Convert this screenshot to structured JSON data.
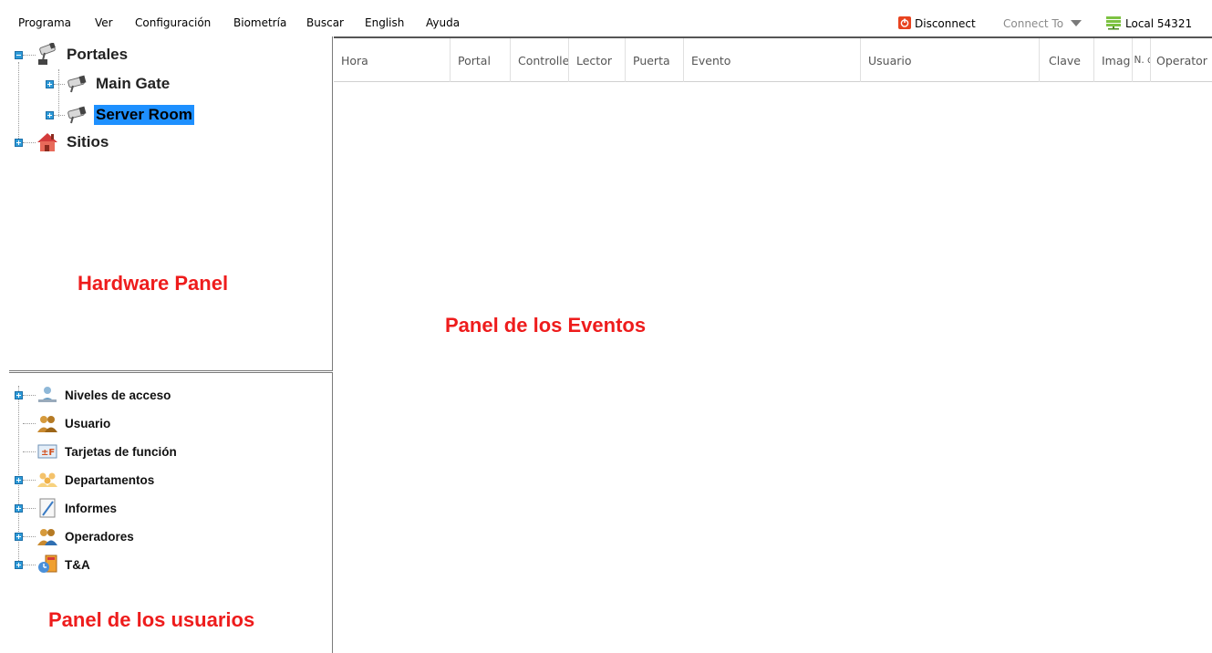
{
  "menu": {
    "items": [
      "Programa",
      "Ver",
      "Configuración",
      "Biometría",
      "Buscar",
      "English",
      "Ayuda"
    ],
    "disconnect_label": "Disconnect",
    "connect_to_label": "Connect To",
    "local_label": "Local 54321"
  },
  "hardware_panel": {
    "root": {
      "label": "Portales",
      "icon": "camera-icon"
    },
    "children": [
      {
        "label": "Main Gate",
        "icon": "camera-icon"
      },
      {
        "label": "Server Room",
        "icon": "camera-icon",
        "selected": true
      }
    ],
    "sites": {
      "label": "Sitios",
      "icon": "house-icon"
    },
    "annotation": "Hardware Panel"
  },
  "user_panel": {
    "items": [
      {
        "label": "Niveles de acceso",
        "icon": "access-level-icon",
        "expandable": true
      },
      {
        "label": "Usuario",
        "icon": "users-icon",
        "expandable": false
      },
      {
        "label": "Tarjetas de función",
        "icon": "function-card-icon",
        "expandable": false
      },
      {
        "label": "Departamentos",
        "icon": "departments-icon",
        "expandable": true
      },
      {
        "label": "Informes",
        "icon": "reports-icon",
        "expandable": true
      },
      {
        "label": "Operadores",
        "icon": "operators-icon",
        "expandable": true
      },
      {
        "label": "T&A",
        "icon": "time-attendance-icon",
        "expandable": true
      }
    ],
    "annotation": "Panel de los usuarios"
  },
  "events_panel": {
    "columns": [
      "Hora",
      "Portal",
      "Controlle",
      "Lector",
      "Puerta",
      "Evento",
      "Usuario",
      "Clave",
      "Imag",
      "N. de",
      "Operator"
    ],
    "annotation": "Panel de los Eventos"
  },
  "colors": {
    "annotation": "#ee1c1c",
    "selection": "#1e90ff",
    "expander": "#2d9ad8",
    "connect_to_text": "#8a8a8a"
  }
}
